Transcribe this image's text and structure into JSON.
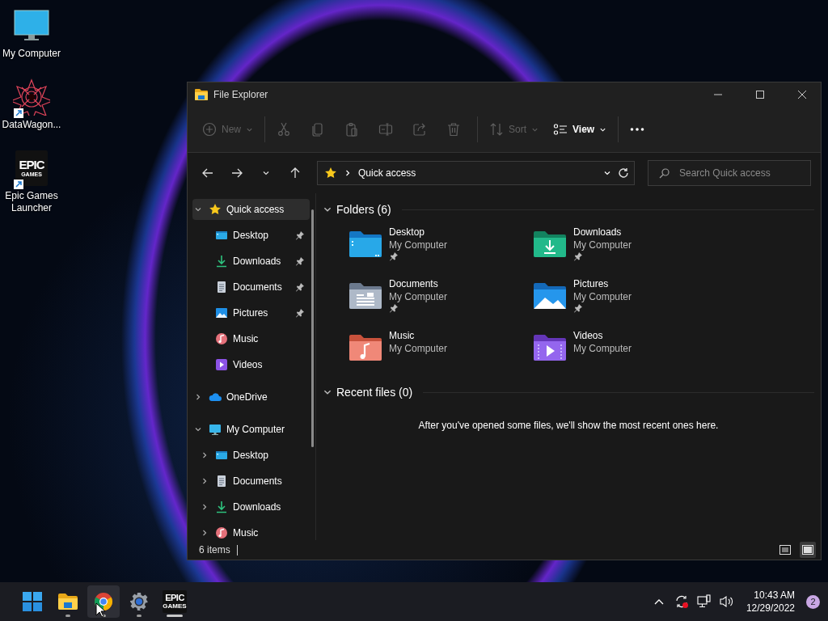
{
  "desktop_icons": [
    {
      "label": "My Computer",
      "kind": "monitor",
      "shortcut": false
    },
    {
      "label": "DataWagon...",
      "kind": "datawagon",
      "shortcut": true
    },
    {
      "label": "Epic Games Launcher",
      "kind": "epic",
      "shortcut": true,
      "logo": {
        "top": "EPIC",
        "bottom": "GAMES"
      }
    }
  ],
  "window": {
    "title": "File Explorer",
    "toolbar": {
      "items": [
        {
          "kind": "new",
          "label": "New",
          "dropdown": true,
          "disabled": true
        },
        {
          "kind": "separator"
        },
        {
          "kind": "cut",
          "disabled": true
        },
        {
          "kind": "copy",
          "disabled": true
        },
        {
          "kind": "paste",
          "disabled": true
        },
        {
          "kind": "rename",
          "disabled": true
        },
        {
          "kind": "share",
          "disabled": true
        },
        {
          "kind": "delete",
          "disabled": true
        },
        {
          "kind": "separator"
        },
        {
          "kind": "sort",
          "label": "Sort",
          "dropdown": true,
          "disabled": true
        },
        {
          "kind": "view",
          "label": "View",
          "dropdown": true,
          "disabled": false
        },
        {
          "kind": "separator"
        },
        {
          "kind": "more",
          "disabled": false
        }
      ]
    },
    "address": {
      "path": "Quick access",
      "search_placeholder": "Search Quick access"
    },
    "sidebar": {
      "items": [
        {
          "label": "Quick access",
          "kind": "star",
          "expanded": true,
          "selected": true,
          "children": [
            {
              "label": "Desktop",
              "kind": "desktop",
              "pinned": true,
              "selected": false
            },
            {
              "label": "Downloads",
              "kind": "downloads",
              "pinned": true,
              "selected": false
            },
            {
              "label": "Documents",
              "kind": "documents",
              "pinned": true,
              "selected": false
            },
            {
              "label": "Pictures",
              "kind": "pictures",
              "pinned": true,
              "selected": false
            },
            {
              "label": "Music",
              "kind": "music",
              "pinned": false,
              "selected": false
            },
            {
              "label": "Videos",
              "kind": "videos",
              "pinned": false,
              "selected": false
            }
          ]
        },
        {
          "label": "OneDrive",
          "kind": "onedrive",
          "expanded": false,
          "selected": false
        },
        {
          "label": "My Computer",
          "kind": "computer",
          "expanded": true,
          "selected": false,
          "children": [
            {
              "label": "Desktop",
              "kind": "desktop",
              "expanded": false,
              "selected": false
            },
            {
              "label": "Documents",
              "kind": "documents",
              "expanded": false,
              "selected": false
            },
            {
              "label": "Downloads",
              "kind": "downloads",
              "expanded": false,
              "selected": false
            },
            {
              "label": "Music",
              "kind": "music",
              "expanded": false,
              "selected": false
            }
          ]
        }
      ]
    },
    "sections": [
      {
        "title": "Folders (6)",
        "expanded": true,
        "folders": [
          {
            "name": "Desktop",
            "location": "My Computer",
            "kind": "desktop",
            "pinned": true
          },
          {
            "name": "Downloads",
            "location": "My Computer",
            "kind": "downloads",
            "pinned": true
          },
          {
            "name": "Documents",
            "location": "My Computer",
            "kind": "documents",
            "pinned": true
          },
          {
            "name": "Pictures",
            "location": "My Computer",
            "kind": "pictures",
            "pinned": true
          },
          {
            "name": "Music",
            "location": "My Computer",
            "kind": "music",
            "pinned": false
          },
          {
            "name": "Videos",
            "location": "My Computer",
            "kind": "videos",
            "pinned": false
          }
        ]
      },
      {
        "title": "Recent files (0)",
        "expanded": true,
        "empty_message": "After you've opened some files, we'll show the most recent ones here."
      }
    ],
    "status_bar": {
      "item_count": "6 items",
      "views": [
        {
          "kind": "details",
          "selected": false
        },
        {
          "kind": "tiles",
          "selected": true
        }
      ]
    }
  },
  "taskbar": {
    "apps": [
      {
        "kind": "explorer",
        "running": true,
        "active": false,
        "hovered": false
      },
      {
        "kind": "chrome",
        "running": true,
        "active": false,
        "hovered": true
      },
      {
        "kind": "settings",
        "running": true,
        "active": false,
        "hovered": false
      },
      {
        "kind": "epic",
        "running": true,
        "active": true,
        "hovered": false,
        "logo": {
          "top": "EPIC",
          "bottom": "GAMES"
        }
      }
    ],
    "tray": {
      "sync_alert": true,
      "time": "10:43 AM",
      "date": "12/29/2022",
      "notifications": "2"
    }
  }
}
